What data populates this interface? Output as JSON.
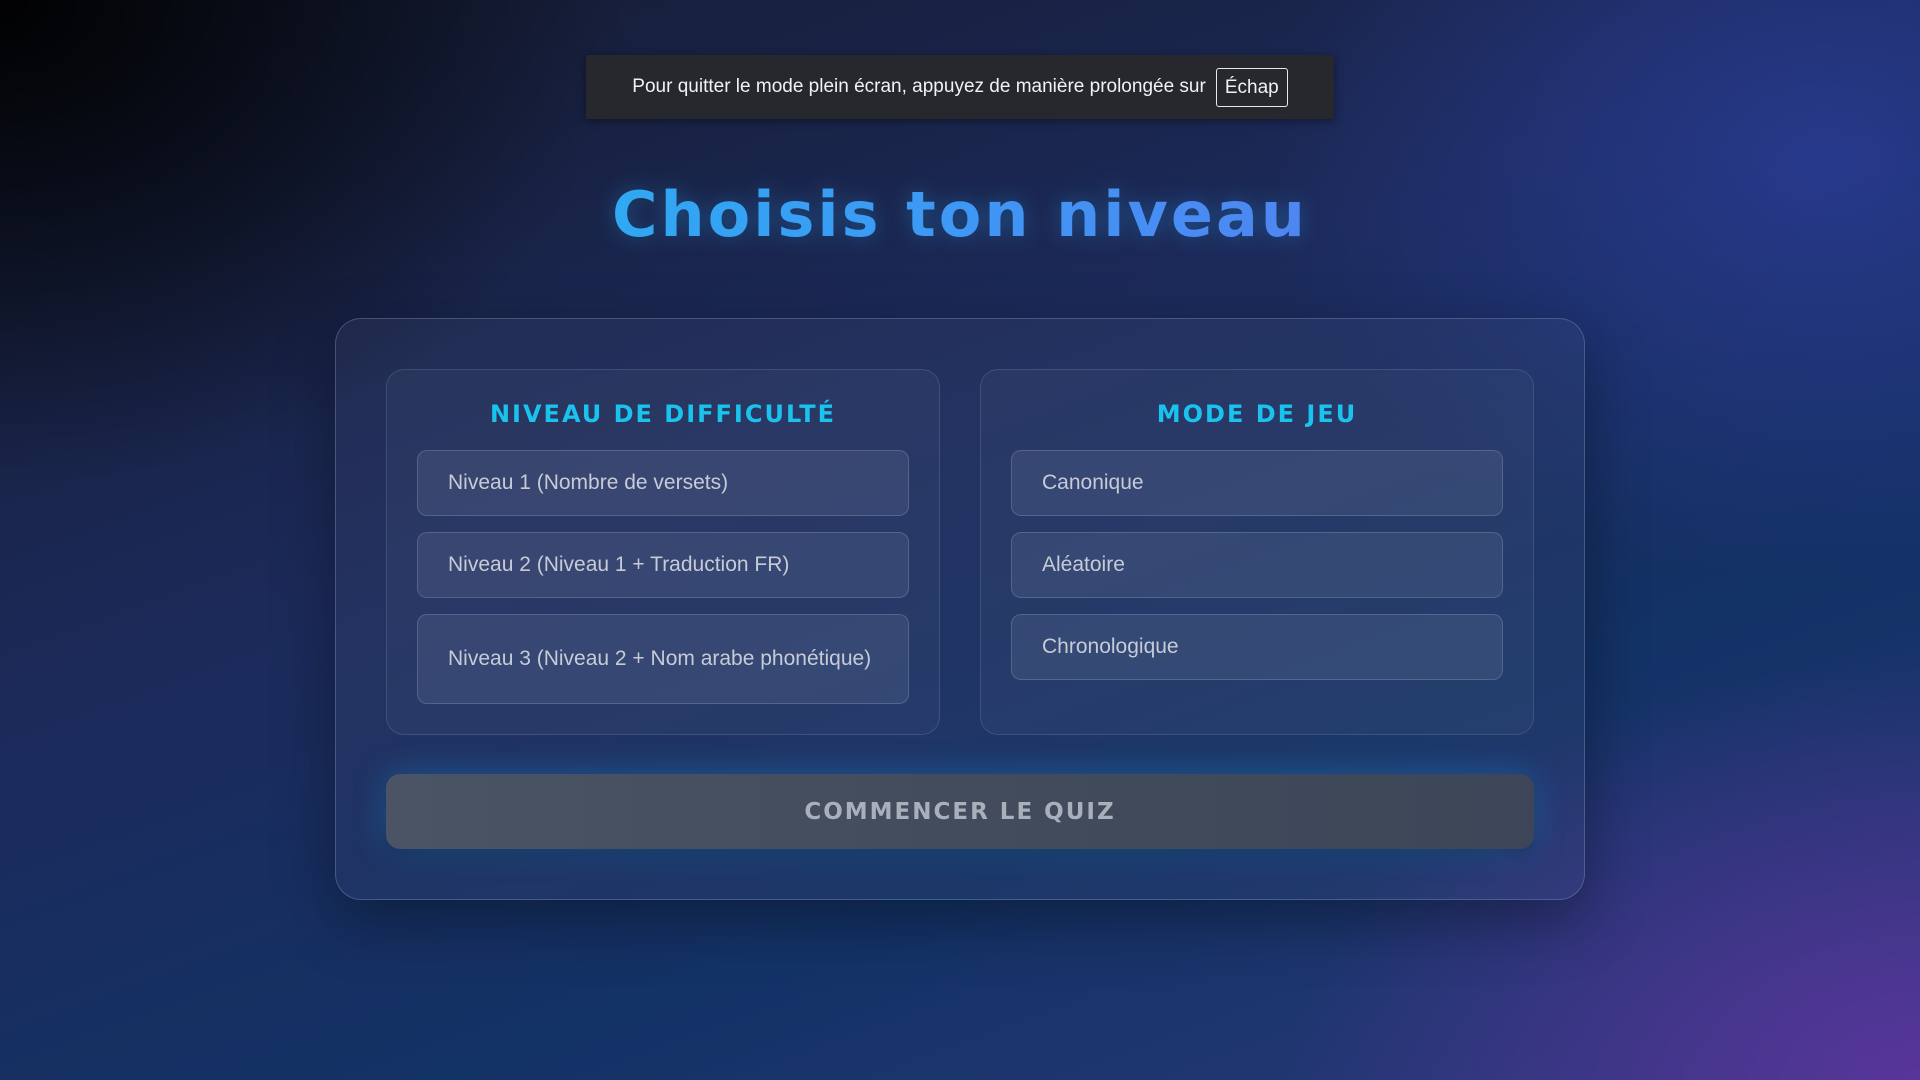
{
  "fullscreen_notice": {
    "text": "Pour quitter le mode plein écran, appuyez de manière prolongée sur",
    "key": "Échap"
  },
  "title": "Choisis ton niveau",
  "difficulty": {
    "title": "NIVEAU DE DIFFICULTÉ",
    "options": [
      {
        "label": "Niveau 1 (Nombre de versets)"
      },
      {
        "label": "Niveau 2 (Niveau 1 + Traduction FR)"
      },
      {
        "label": "Niveau 3 (Niveau 2 + Nom arabe phonétique)"
      }
    ]
  },
  "game_mode": {
    "title": "MODE DE JEU",
    "options": [
      {
        "label": "Canonique"
      },
      {
        "label": "Aléatoire"
      },
      {
        "label": "Chronologique"
      }
    ]
  },
  "start_button": {
    "label": "COMMENCER LE QUIZ"
  },
  "colors": {
    "accent": "#19c3ee",
    "title_gradient_start": "#18c6ee",
    "title_gradient_end": "#6c66f0"
  }
}
